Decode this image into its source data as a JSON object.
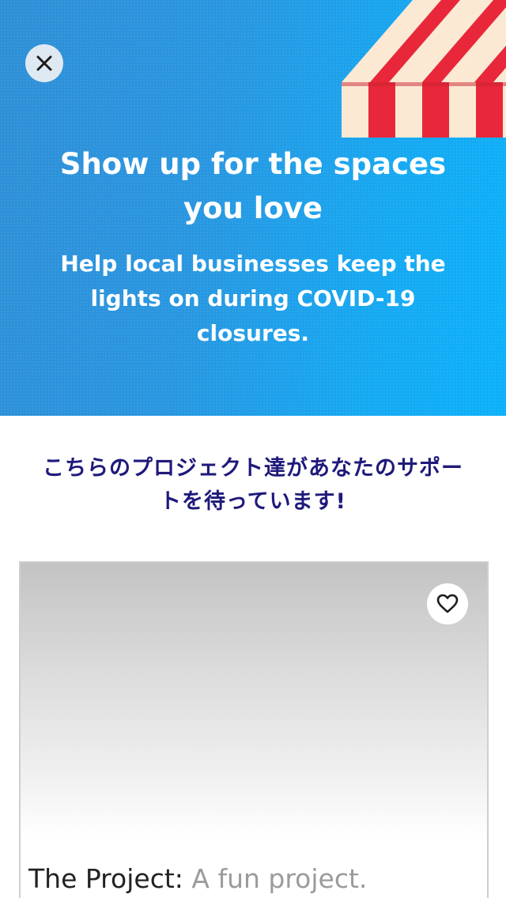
{
  "hero": {
    "title_line1": "Show up for the spaces",
    "title_line2": "you love",
    "subtitle_line1": "Help local businesses keep the",
    "subtitle_line2": "lights on during COVID-19",
    "subtitle_line3": "closures.",
    "background_color": "#1ea3ec",
    "close_icon": "close-icon",
    "illustration": "striped-awning"
  },
  "section": {
    "heading_line1": "こちらのプロジェクト達があなたのサポー",
    "heading_line2": "トを待っています!"
  },
  "project": {
    "name": "The Project:",
    "description": " A fun project.",
    "favorite_icon": "heart-outline-icon"
  },
  "colors": {
    "heading_text": "#1f1a7a",
    "awning_red": "#e8283a",
    "awning_cream": "#fbe9d4"
  }
}
